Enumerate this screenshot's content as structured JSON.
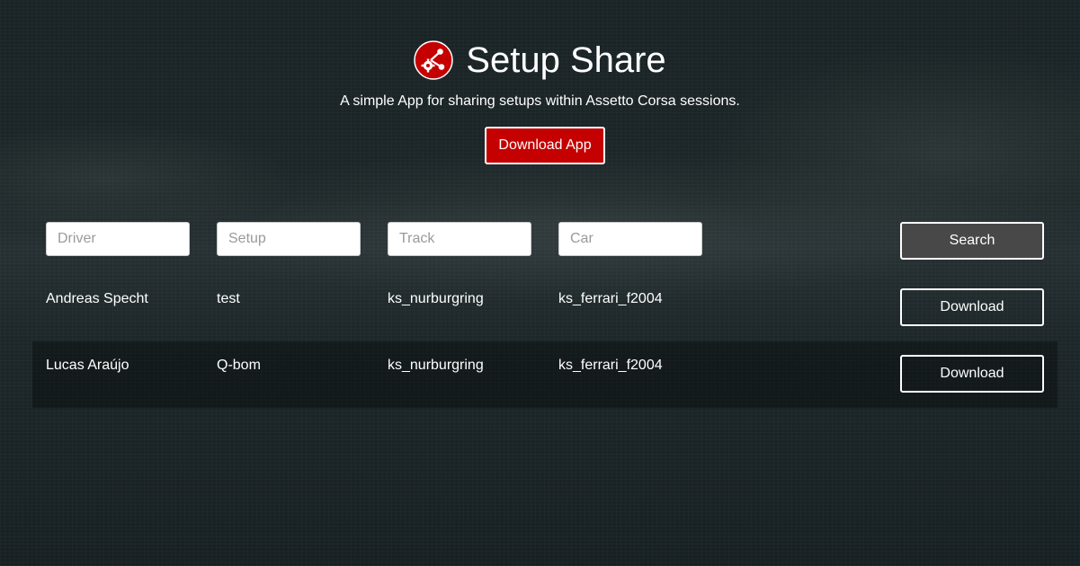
{
  "header": {
    "title": "Setup Share",
    "subtitle": "A simple App for sharing setups within Assetto Corsa sessions.",
    "download_app_label": "Download App",
    "logo_icon": "share-gear-icon",
    "accent_color": "#c40000"
  },
  "filters": {
    "driver_placeholder": "Driver",
    "setup_placeholder": "Setup",
    "track_placeholder": "Track",
    "car_placeholder": "Car",
    "driver_value": "",
    "setup_value": "",
    "track_value": "",
    "car_value": "",
    "search_label": "Search"
  },
  "rows": [
    {
      "driver": "Andreas Specht",
      "setup": "test",
      "track": "ks_nurburgring",
      "car": "ks_ferrari_f2004",
      "action_label": "Download"
    },
    {
      "driver": "Lucas Araújo",
      "setup": "Q-bom",
      "track": "ks_nurburgring",
      "car": "ks_ferrari_f2004",
      "action_label": "Download"
    }
  ]
}
